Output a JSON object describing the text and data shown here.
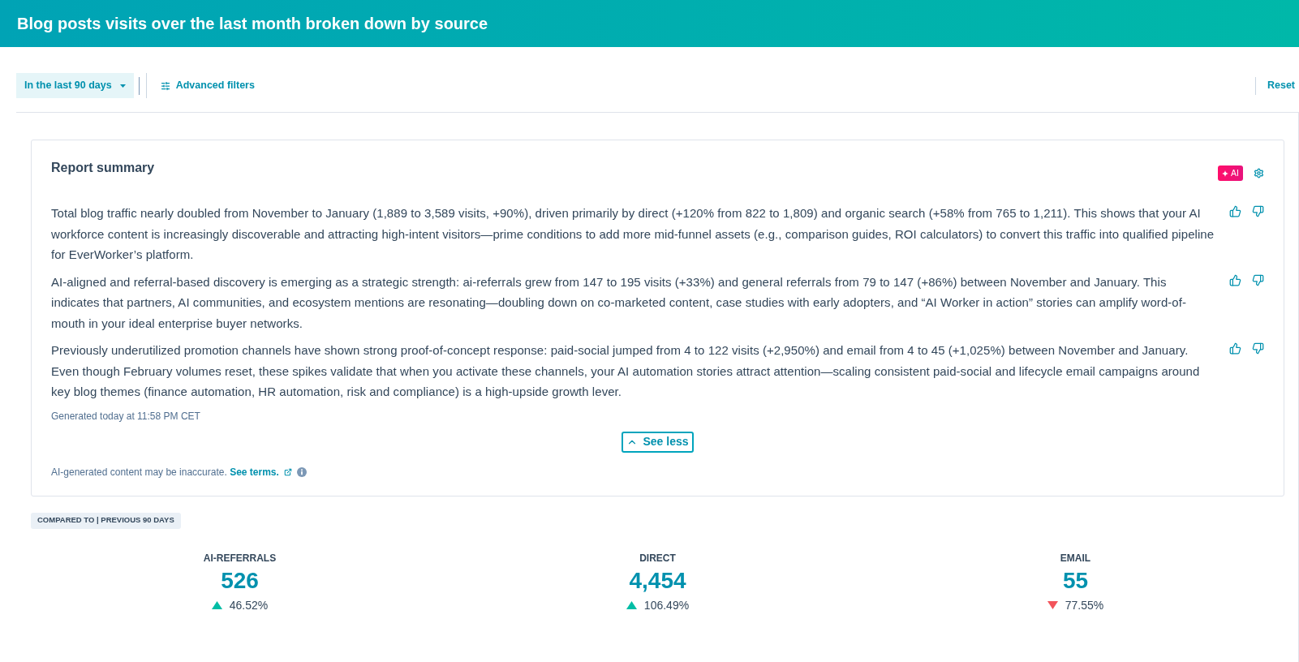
{
  "header": {
    "title": "Blog posts visits over the last month broken down by source"
  },
  "filters": {
    "date_range": {
      "label": "In the last 90 days"
    },
    "advanced_filters": {
      "label": "Advanced filters"
    },
    "reset": {
      "label": "Reset"
    }
  },
  "report_summary": {
    "title": "Report summary",
    "ai_badge": {
      "label": "AI"
    },
    "paragraphs": [
      {
        "text": "Total blog traffic nearly doubled from November to January (1,889 to 3,589 visits, +90%), driven primarily by direct (+120% from 822 to 1,809) and organic search (+58% from 765 to 1,211). This shows that your AI workforce content is increasingly discoverable and attracting high-intent visitors—prime conditions to add more mid-funnel assets (e.g., comparison guides, ROI calculators) to convert this traffic into qualified pipeline for EverWorker’s platform."
      },
      {
        "text": "AI-aligned and referral-based discovery is emerging as a strategic strength: ai-referrals grew from 147 to 195 visits (+33%) and general referrals from 79 to 147 (+86%) between November and January. This indicates that partners, AI communities, and ecosystem mentions are resonating—doubling down on co-marketed content, case studies with early adopters, and “AI Worker in action” stories can amplify word-of-mouth in your ideal enterprise buyer networks."
      },
      {
        "text": "Previously underutilized promotion channels have shown strong proof-of-concept response: paid-social jumped from 4 to 122 visits (+2,950%) and email from 4 to 45 (+1,025%) between November and January. Even though February volumes reset, these spikes validate that when you activate these channels, your AI automation stories attract attention—scaling consistent paid-social and lifecycle email campaigns around key blog themes (finance automation, HR automation, risk and compliance) is a high-upside growth lever."
      }
    ],
    "generated": "Generated today at 11:58 PM CET",
    "toggle": {
      "label": "See less",
      "expanded": true,
      "focused": true
    },
    "disclaimer": {
      "text": "AI-generated content may be inaccurate.",
      "link": "See terms."
    }
  },
  "comparison": {
    "label": "COMPARED TO | PREVIOUS 90 DAYS"
  },
  "metrics": [
    {
      "label": "AI-REFERRALS",
      "value": "526",
      "change": "46.52%",
      "kind": "increase"
    },
    {
      "label": "DIRECT",
      "value": "4,454",
      "change": "106.49%",
      "kind": "increase"
    },
    {
      "label": "EMAIL",
      "value": "55",
      "change": "77.55%",
      "kind": "decrease"
    }
  ]
}
